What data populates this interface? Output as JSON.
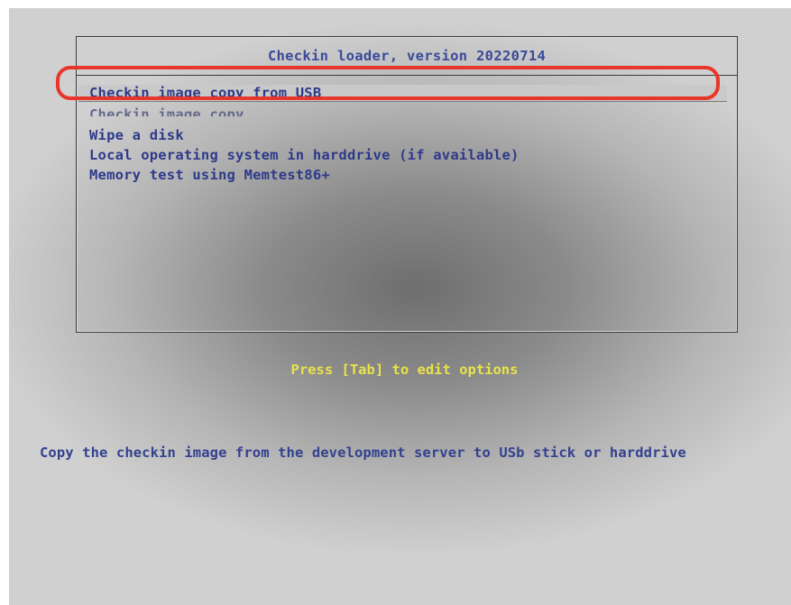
{
  "menu": {
    "title": "Checkin loader, version 20220714",
    "items": [
      {
        "label": "Checkin image copy from USB",
        "selected": true
      },
      {
        "label": "Checkin image copy",
        "partially_hidden": true
      },
      {
        "label": "Wipe a disk"
      },
      {
        "label": "Local operating system in harddrive (if available)"
      },
      {
        "label": "Memory test using Memtest86+"
      }
    ]
  },
  "hint": "Press [Tab] to edit options",
  "help_text": "Copy the checkin image from the development server to USb stick or harddrive",
  "colors": {
    "menu_text": "#2d3a8a",
    "hint_text": "#e9e24a",
    "annotation_ring": "#e8362a"
  }
}
